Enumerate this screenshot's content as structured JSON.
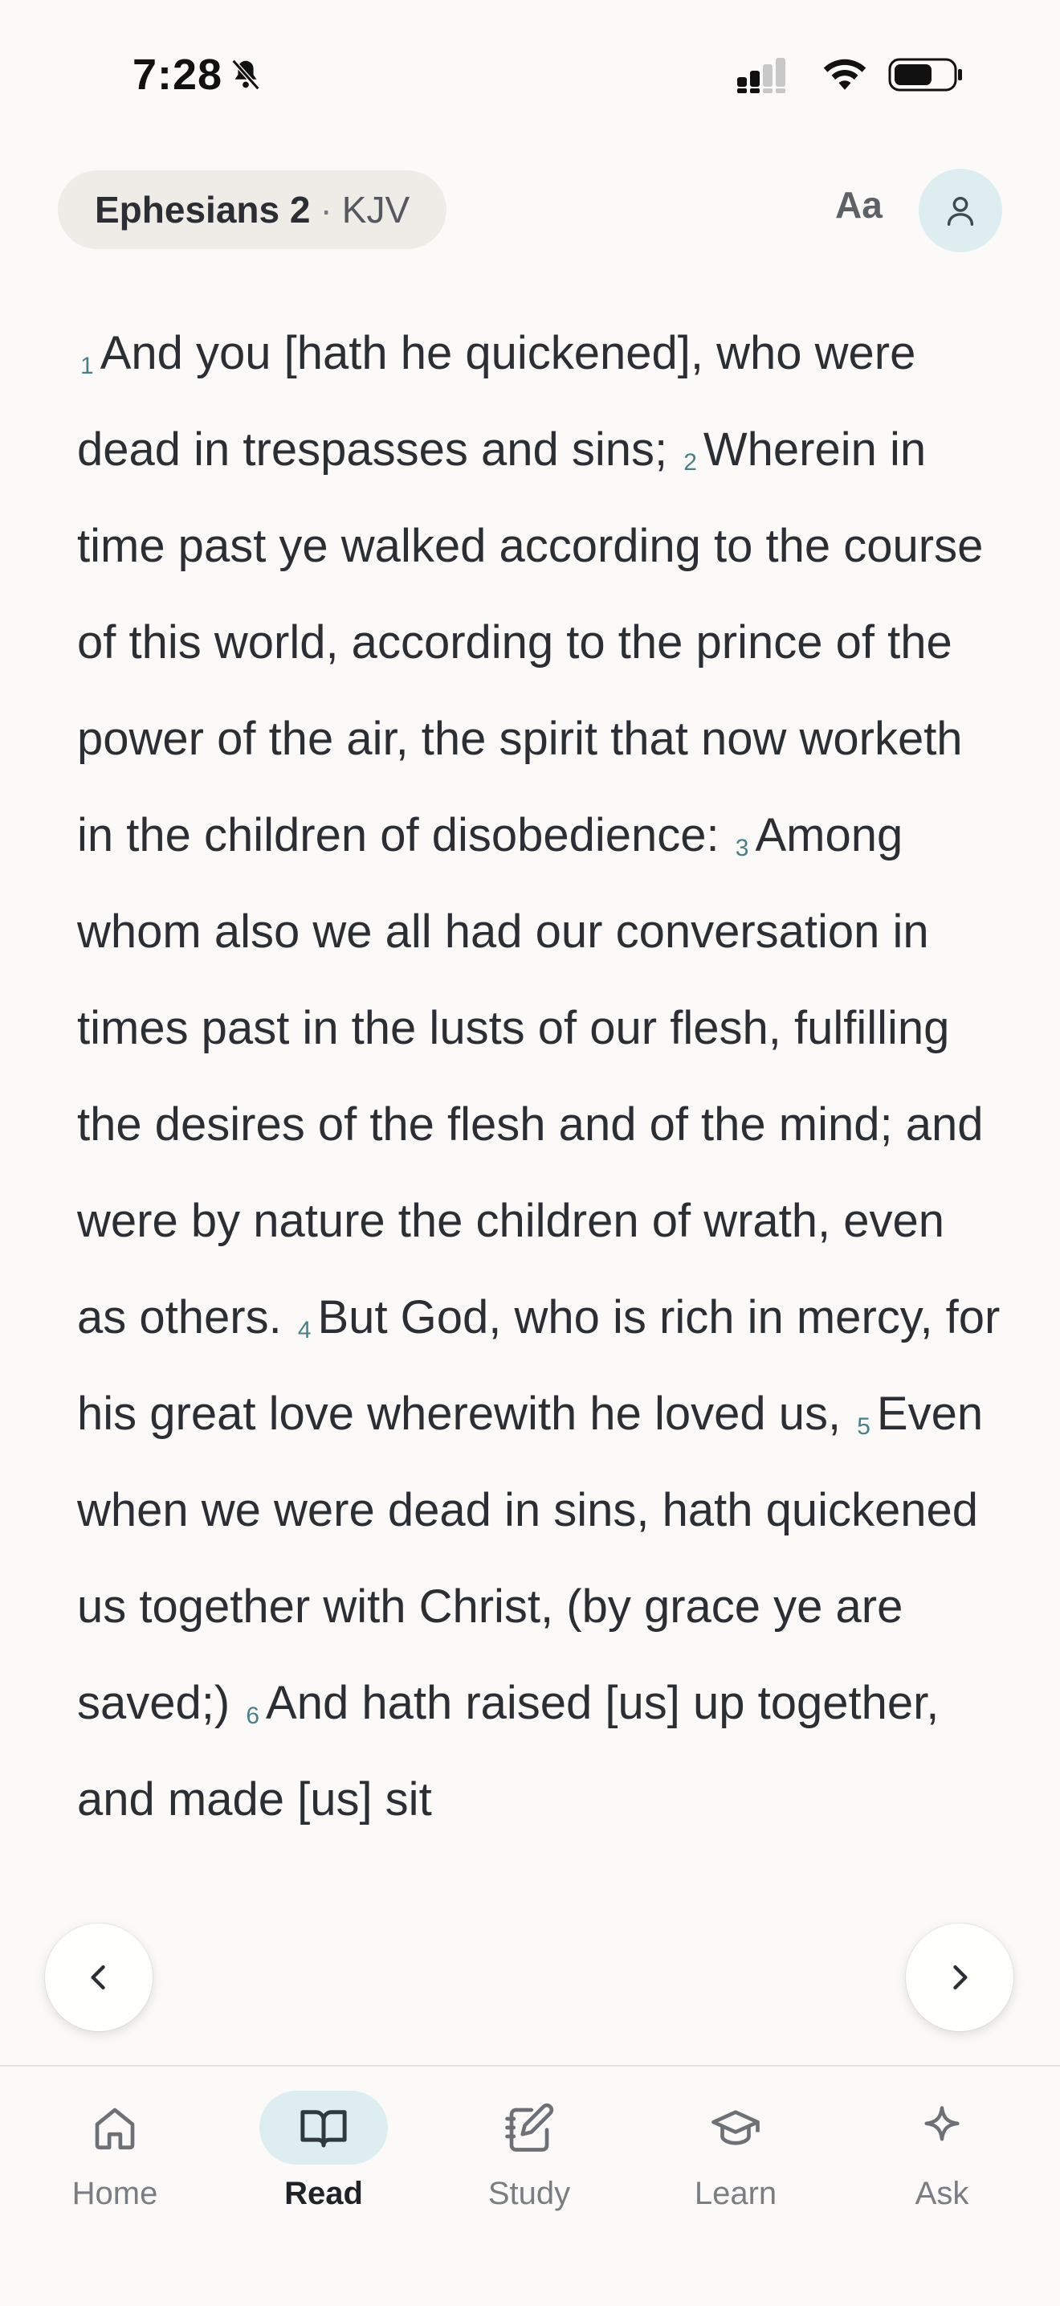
{
  "status_bar": {
    "time": "7:28"
  },
  "header": {
    "book": "Ephesians 2",
    "separator": "·",
    "version": "KJV",
    "font_button_label": "Aa"
  },
  "scripture": {
    "verses": [
      {
        "num": "1",
        "text": "And you [hath he quickened], who were dead in trespasses and sins;"
      },
      {
        "num": "2",
        "text": "Wherein in time past ye walked according to the course of this world, according to the prince of the power of the air, the spirit that now worketh in the children of disobedience:"
      },
      {
        "num": "3",
        "text": "Among whom also we all had our conversation in times past in the lusts of our flesh, fulfilling the desires of the flesh and of the mind; and were by nature the children of wrath, even as others."
      },
      {
        "num": "4",
        "text": "But God, who is rich in mercy, for his great love wherewith he loved us,"
      },
      {
        "num": "5",
        "text": "Even when we were dead in sins, hath quickened us together with Christ, (by grace ye are saved;)"
      },
      {
        "num": "6",
        "text": "And hath raised [us] up together, and made [us] sit"
      }
    ]
  },
  "tabs": [
    {
      "label": "Home",
      "icon": "home-icon"
    },
    {
      "label": "Read",
      "icon": "book-icon",
      "active": true
    },
    {
      "label": "Study",
      "icon": "notebook-pen-icon"
    },
    {
      "label": "Learn",
      "icon": "graduation-cap-icon"
    },
    {
      "label": "Ask",
      "icon": "sparkle-icon"
    }
  ],
  "colors": {
    "accent": "#4b7f86",
    "active_tab_bg": "#deedf0",
    "background": "#fbfaf9"
  }
}
